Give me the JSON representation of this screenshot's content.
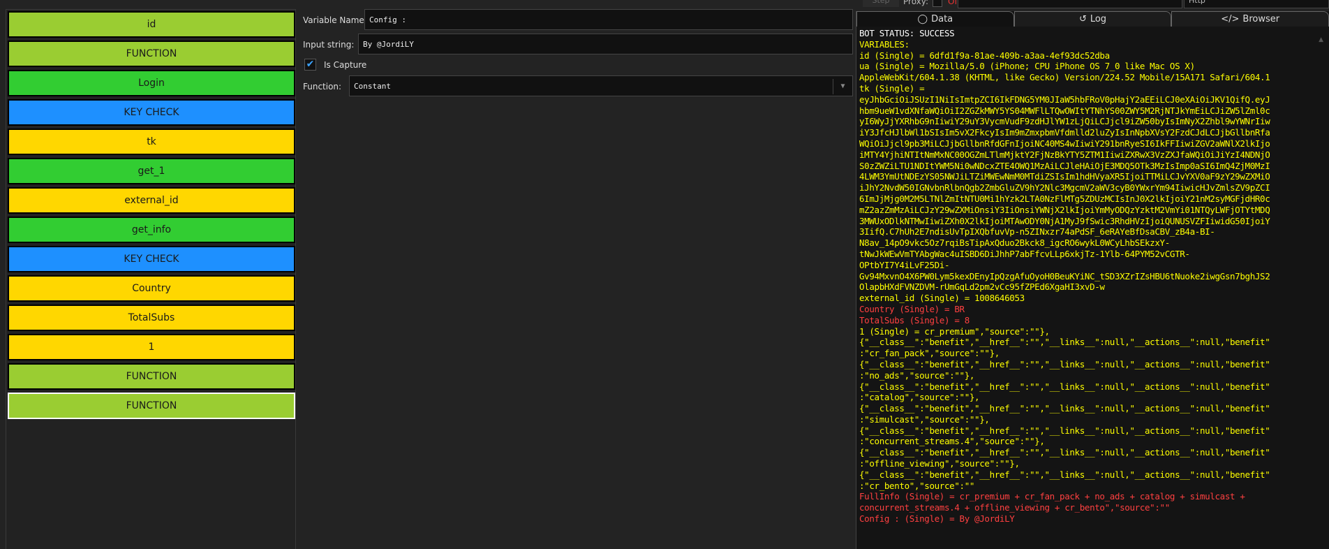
{
  "topbar": {
    "step_label": "Step",
    "proxy_label": "Proxy:",
    "proxy_state": "Off",
    "method": "Http"
  },
  "blocks": [
    {
      "label": "id",
      "color": "#9ACD32"
    },
    {
      "label": "FUNCTION",
      "color": "#9ACD32"
    },
    {
      "label": "Login",
      "color": "#32CD32"
    },
    {
      "label": "KEY CHECK",
      "color": "#1E90FF"
    },
    {
      "label": "tk",
      "color": "#FFD700"
    },
    {
      "label": "get_1",
      "color": "#32CD32"
    },
    {
      "label": "external_id",
      "color": "#FFD700"
    },
    {
      "label": "get_info",
      "color": "#32CD32"
    },
    {
      "label": "KEY CHECK",
      "color": "#1E90FF"
    },
    {
      "label": "Country",
      "color": "#FFD700"
    },
    {
      "label": "TotalSubs",
      "color": "#FFD700"
    },
    {
      "label": "1",
      "color": "#FFD700"
    },
    {
      "label": "FUNCTION",
      "color": "#9ACD32"
    },
    {
      "label": "FUNCTION",
      "color": "#9ACD32",
      "selected": true
    }
  ],
  "editor": {
    "variable_name_label": "Variable Name:",
    "variable_name": "Config :",
    "input_string_label": "Input string:",
    "input_string": "By @JordiLY",
    "is_capture_label": "Is Capture",
    "is_capture": true,
    "function_label": "Function:",
    "function": "Constant"
  },
  "tabs": [
    {
      "label": "Data",
      "icon": "refresh-icon"
    },
    {
      "label": "Log",
      "icon": "history-icon"
    },
    {
      "label": "Browser",
      "icon": "code-icon"
    }
  ],
  "colors": {
    "white": "#FFFFFF",
    "yellow": "#FFFF00",
    "red": "#FF4040"
  },
  "log": [
    {
      "t": "BOT STATUS: SUCCESS",
      "c": "white"
    },
    {
      "t": "VARIABLES:",
      "c": "yellow"
    },
    {
      "t": "id (Single) = 6dfd1f9a-81ae-409b-a3aa-4ef93dc52dba",
      "c": "yellow"
    },
    {
      "t": "ua (Single) = Mozilla/5.0 (iPhone; CPU iPhone OS 7_0 like Mac OS X)",
      "c": "yellow"
    },
    {
      "t": "AppleWebKit/604.1.38 (KHTML, like Gecko) Version/224.52 Mobile/15A171 Safari/604.1",
      "c": "yellow"
    },
    {
      "t": "tk (Single) =",
      "c": "yellow"
    },
    {
      "t": "eyJhbGciOiJSUzI1NiIsImtpZCI6IkFDNG5YM0JIaW5hbFRoV0pHajY2aEEiLCJ0eXAiOiJKV1QifQ.eyJ",
      "c": "yellow"
    },
    {
      "t": "hbm9ueW1vdXNfaWQiOiI2ZGZkMWY5YS04MWFlLTQwOWItYTNhYS00ZWY5M2RjNTJkYmEiLCJiZW5lZml0c",
      "c": "yellow"
    },
    {
      "t": "yI6WyJjYXRhbG9nIiwiY29uY3VycmVudF9zdHJlYW1zLjQiLCJjcl9iZW50byIsImNyX2Zhbl9wYWNrIiw",
      "c": "yellow"
    },
    {
      "t": "iY3JfcHJlbWl1bSIsIm5vX2FkcyIsIm9mZmxpbmVfdmlld2luZyIsInNpbXVsY2FzdCJdLCJjbGllbnRfa",
      "c": "yellow"
    },
    {
      "t": "WQiOiJjcl9pb3MiLCJjbGllbnRfdGFnIjoiNC40MS4wIiwiY291bnRyeSI6IkFFIiwiZGV2aWNlX2lkIjo",
      "c": "yellow"
    },
    {
      "t": "iMTY4YjhiNTItNmMxNC00OGZmLTlmMjktY2FjNzBkYTY5ZTM1IiwiZXRwX3VzZXJfaWQiOiJiYzI4NDNjO",
      "c": "yellow"
    },
    {
      "t": "S0zZWZiLTU1NDItYWM5Ni0wNDcxZTE4OWQ1MzAiLCJleHAiOjE3MDQ5OTk3MzIsImp0aSI6ImQ4ZjM0MzI",
      "c": "yellow"
    },
    {
      "t": "4LWM3YmUtNDEzYS05NWJiLTZiMWEwNmM0MTdiZSIsIm1hdHVyaXR5IjoiTTMiLCJvYXV0aF9zY29wZXMiO",
      "c": "yellow"
    },
    {
      "t": "iJhY2NvdW50IGNvbnRlbnQgb2ZmbGluZV9hY2Nlc3MgcmV2aWV3cyB0YWxrYm94IiwicHJvZmlsZV9pZCI",
      "c": "yellow"
    },
    {
      "t": "6ImJjMjg0M2M5LTNlZmItNTU0Mi1hYzk2LTA0NzFlMTg5ZDUzMCIsInJ0X2lkIjoiY21nM2syMGFjdHR0c",
      "c": "yellow"
    },
    {
      "t": "mZ2azZmMzAiLCJzY29wZXMiOnsiY3IiOnsiYWNjX2lkIjoiYmMyODQzYzktM2VmYi01NTQyLWFjOTYtMDQ",
      "c": "yellow"
    },
    {
      "t": "3MWUxODlkNTMwIiwiZXh0X2lkIjoiMTAwODY0NjA1MyJ9fSwic3RhdHVzIjoiQUNUSVZFIiwidG50IjoiY",
      "c": "yellow"
    },
    {
      "t": "3IifQ.C7hUh2E7ndisUvTpIXQbfuvVp-n5ZINxzr74aPdSF_6eRAYeBfDsaCBV_zB4a-BI-",
      "c": "yellow"
    },
    {
      "t": "N8av_14pO9vkc5Oz7rqiBsTipAxQduo2Bkck8_igcRO6wykL0WCyLhbSEkzxY-",
      "c": "yellow"
    },
    {
      "t": "tNwJkWEwVmTYAbgWac4uISBD6DiJhhP7abFfcvLLp6xkjTz-1Ylb-64PYM52vCGTR-",
      "c": "yellow"
    },
    {
      "t": "OPtbYI7Y4iLvF25Di-",
      "c": "yellow"
    },
    {
      "t": "Gv94MxvnO4X6PW0Lym5kexDEnyIpQzgAfuOyoH0BeuKYiNC_tSD3XZrIZsHBU6tNuoke2iwgGsn7bghJS2",
      "c": "yellow"
    },
    {
      "t": "OlapbHXdFVNZDVM-rUmGqLd2pm2vCc95fZPEd6XgaHI3xvD-w",
      "c": "yellow"
    },
    {
      "t": "external_id (Single) = 1008646053",
      "c": "yellow"
    },
    {
      "t": "Country (Single) = BR",
      "c": "red"
    },
    {
      "t": "TotalSubs (Single) = 8",
      "c": "red"
    },
    {
      "t": "1 (Single) = cr_premium\",\"source\":\"\"},",
      "c": "yellow"
    },
    {
      "t": "{\"__class__\":\"benefit\",\"__href__\":\"\",\"__links__\":null,\"__actions__\":null,\"benefit\"",
      "c": "yellow"
    },
    {
      "t": ":\"cr_fan_pack\",\"source\":\"\"},",
      "c": "yellow"
    },
    {
      "t": "{\"__class__\":\"benefit\",\"__href__\":\"\",\"__links__\":null,\"__actions__\":null,\"benefit\"",
      "c": "yellow"
    },
    {
      "t": ":\"no_ads\",\"source\":\"\"},",
      "c": "yellow"
    },
    {
      "t": "{\"__class__\":\"benefit\",\"__href__\":\"\",\"__links__\":null,\"__actions__\":null,\"benefit\"",
      "c": "yellow"
    },
    {
      "t": ":\"catalog\",\"source\":\"\"},",
      "c": "yellow"
    },
    {
      "t": "{\"__class__\":\"benefit\",\"__href__\":\"\",\"__links__\":null,\"__actions__\":null,\"benefit\"",
      "c": "yellow"
    },
    {
      "t": ":\"simulcast\",\"source\":\"\"},",
      "c": "yellow"
    },
    {
      "t": "{\"__class__\":\"benefit\",\"__href__\":\"\",\"__links__\":null,\"__actions__\":null,\"benefit\"",
      "c": "yellow"
    },
    {
      "t": ":\"concurrent_streams.4\",\"source\":\"\"},",
      "c": "yellow"
    },
    {
      "t": "{\"__class__\":\"benefit\",\"__href__\":\"\",\"__links__\":null,\"__actions__\":null,\"benefit\"",
      "c": "yellow"
    },
    {
      "t": ":\"offline_viewing\",\"source\":\"\"},",
      "c": "yellow"
    },
    {
      "t": "{\"__class__\":\"benefit\",\"__href__\":\"\",\"__links__\":null,\"__actions__\":null,\"benefit\"",
      "c": "yellow"
    },
    {
      "t": ":\"cr_bento\",\"source\":\"\"",
      "c": "yellow"
    },
    {
      "t": "FullInfo (Single) = cr_premium + cr_fan_pack + no_ads + catalog + simulcast +",
      "c": "red"
    },
    {
      "t": "concurrent_streams.4 + offline_viewing + cr_bento\",\"source\":\"\"",
      "c": "red"
    },
    {
      "t": "Config : (Single) = By @JordiLY",
      "c": "red"
    }
  ]
}
